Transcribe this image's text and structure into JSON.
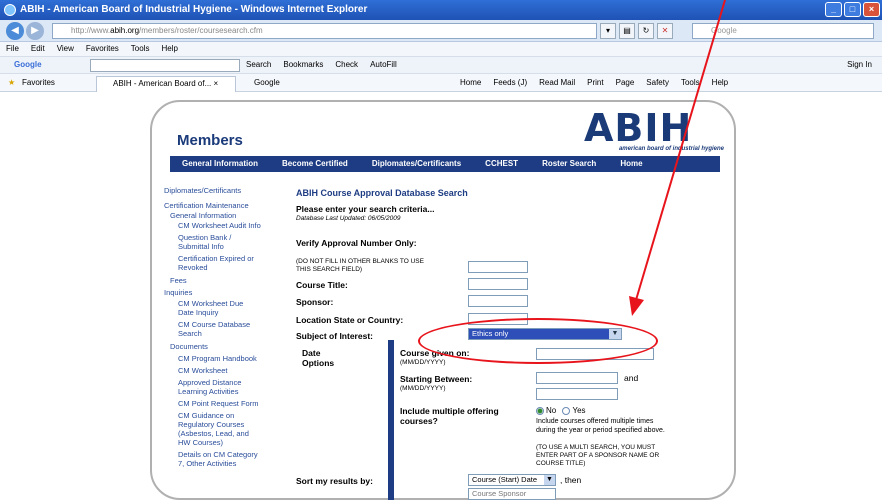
{
  "window": {
    "title": "ABIH - American Board of Industrial Hygiene - Windows Internet Explorer"
  },
  "address": {
    "url_prefix": "http://www.",
    "url_host": "abih.org",
    "url_path": "/members/roster/coursesearch.cfm",
    "search_placeholder": "Google"
  },
  "menu": [
    "File",
    "Edit",
    "View",
    "Favorites",
    "Tools",
    "Help"
  ],
  "googlebar": {
    "label": "Google",
    "tools": [
      "Search",
      "Bookmarks",
      "Check",
      "AutoFill"
    ],
    "signin": "Sign In"
  },
  "favbar": {
    "favorites": "Favorites",
    "tab1": "ABIH - American Board of...",
    "tab2": "Google",
    "commands": [
      "Home",
      "Feeds (J)",
      "Read Mail",
      "Print",
      "Page",
      "Safety",
      "Tools",
      "Help"
    ]
  },
  "site": {
    "members": "Members",
    "logo_letters": "ABIH",
    "logo_sub": "american board of industrial hygiene",
    "nav": [
      "General Information",
      "Become Certified",
      "Diplomates/Certificants",
      "CCHEST",
      "Roster Search",
      "Home"
    ]
  },
  "sidebar": [
    "Diplomates/Certificants",
    "Certification Maintenance",
    "General Information",
    "CM Worksheet Audit Info",
    "Question Bank /",
    "Submittal Info",
    "Certification Expired or",
    "Revoked",
    "Fees",
    "Inquiries",
    "CM Worksheet Due",
    "Date Inquiry",
    "CM Course Database",
    "Search",
    "Documents",
    "CM Program Handbook",
    "CM Worksheet",
    "Approved Distance",
    "Learning Activities",
    "CM Point Request Form",
    "CM Guidance on",
    "Regulatory Courses",
    "(Asbestos, Lead, and",
    "HW Courses)",
    "Details on CM Category",
    "7, Other Activities"
  ],
  "form": {
    "heading": "ABIH Course Approval Database Search",
    "criteria": "Please enter your search criteria...",
    "updated": "Database Last Updated: 06/05/2009",
    "verify_label": "Verify Approval Number Only:",
    "verify_note": "(DO NOT FILL IN OTHER BLANKS TO USE THIS SEARCH FIELD)",
    "course_title": "Course Title:",
    "sponsor": "Sponsor:",
    "location": "Location State or Country:",
    "subject": "Subject of Interest:",
    "subject_value": "Ethics only",
    "date_options": "Date Options",
    "course_given": "Course given on:",
    "mmdd1": "(MM/DD/YYYY)",
    "starting_between": "Starting Between:",
    "mmdd2": "(MM/DD/YYYY)",
    "and": "and",
    "multiple_label": "Include multiple offering courses?",
    "no": "No",
    "yes": "Yes",
    "multiple_note": "Include courses offered multiple times during the year or period specified above.",
    "multi_search_note": "(TO USE A MULTI SEARCH, YOU MUST ENTER PART OF A SPONSOR NAME OR COURSE TITLE)",
    "sort_label": "Sort my results by:",
    "sort_value": "Course (Start) Date",
    "then": ", then",
    "sort_value2": "Course Sponsor"
  },
  "annotation_color": "#e8141c"
}
